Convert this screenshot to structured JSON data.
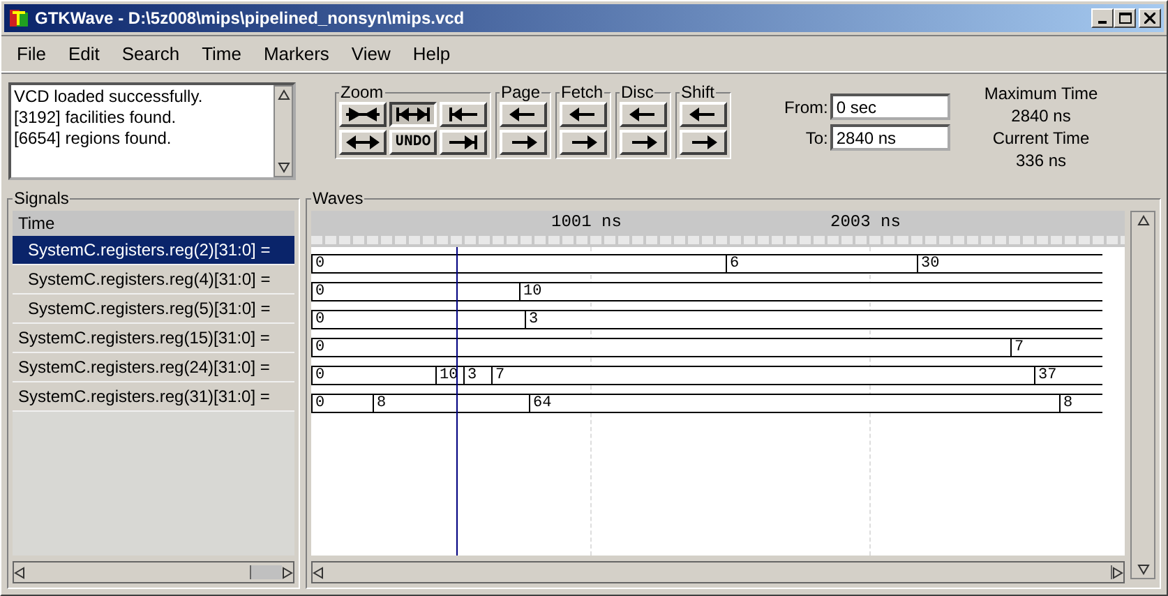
{
  "window": {
    "title": "GTKWave - D:\\5z008\\mips\\pipelined_nonsyn\\mips.vcd"
  },
  "menu": [
    "File",
    "Edit",
    "Search",
    "Time",
    "Markers",
    "View",
    "Help"
  ],
  "log": [
    "VCD loaded successfully.",
    "[3192] facilities found.",
    "[6654] regions found."
  ],
  "toolbar": [
    {
      "label": "Zoom",
      "buttons": [
        {
          "kind": "zoom-fit"
        },
        {
          "kind": "zoom-full",
          "selected": true
        },
        {
          "kind": "to-start"
        },
        {
          "kind": "zoom-out"
        },
        {
          "kind": "undo",
          "text": "UNDO"
        },
        {
          "kind": "to-end"
        }
      ]
    },
    {
      "label": "Page",
      "buttons": [
        {
          "kind": "left"
        },
        {
          "kind": "right"
        }
      ]
    },
    {
      "label": "Fetch",
      "buttons": [
        {
          "kind": "left"
        },
        {
          "kind": "right"
        }
      ]
    },
    {
      "label": "Disc",
      "buttons": [
        {
          "kind": "left"
        },
        {
          "kind": "right"
        }
      ]
    },
    {
      "label": "Shift",
      "buttons": [
        {
          "kind": "left"
        },
        {
          "kind": "right"
        }
      ]
    }
  ],
  "range": {
    "from_label": "From:",
    "from": "0 sec",
    "to_label": "To:",
    "to": "2840 ns"
  },
  "times": {
    "max_label": "Maximum Time",
    "max": "2840 ns",
    "current_label": "Current Time",
    "current": "336 ns"
  },
  "signals": {
    "title": "Signals",
    "header": "Time",
    "items": [
      {
        "name": "SystemC.registers.reg(2)[31:0] =",
        "selected": true,
        "indented": true
      },
      {
        "name": "SystemC.registers.reg(4)[31:0] =",
        "selected": false,
        "indented": true
      },
      {
        "name": "SystemC.registers.reg(5)[31:0] =",
        "selected": false,
        "indented": true
      },
      {
        "name": "SystemC.registers.reg(15)[31:0] =",
        "selected": false,
        "indented": false
      },
      {
        "name": "SystemC.registers.reg(24)[31:0] =",
        "selected": false,
        "indented": false
      },
      {
        "name": "SystemC.registers.reg(31)[31:0] =",
        "selected": false,
        "indented": false
      }
    ]
  },
  "waves": {
    "title": "Waves",
    "ruler": [
      "1001 ns",
      "2003 ns"
    ],
    "rows": [
      [
        "0",
        "6",
        "30"
      ],
      [
        "0",
        "10"
      ],
      [
        "0",
        "3"
      ],
      [
        "0",
        "7"
      ],
      [
        "0",
        "10",
        "3",
        "7",
        "37"
      ],
      [
        "0",
        "8",
        "64",
        "8"
      ]
    ]
  }
}
